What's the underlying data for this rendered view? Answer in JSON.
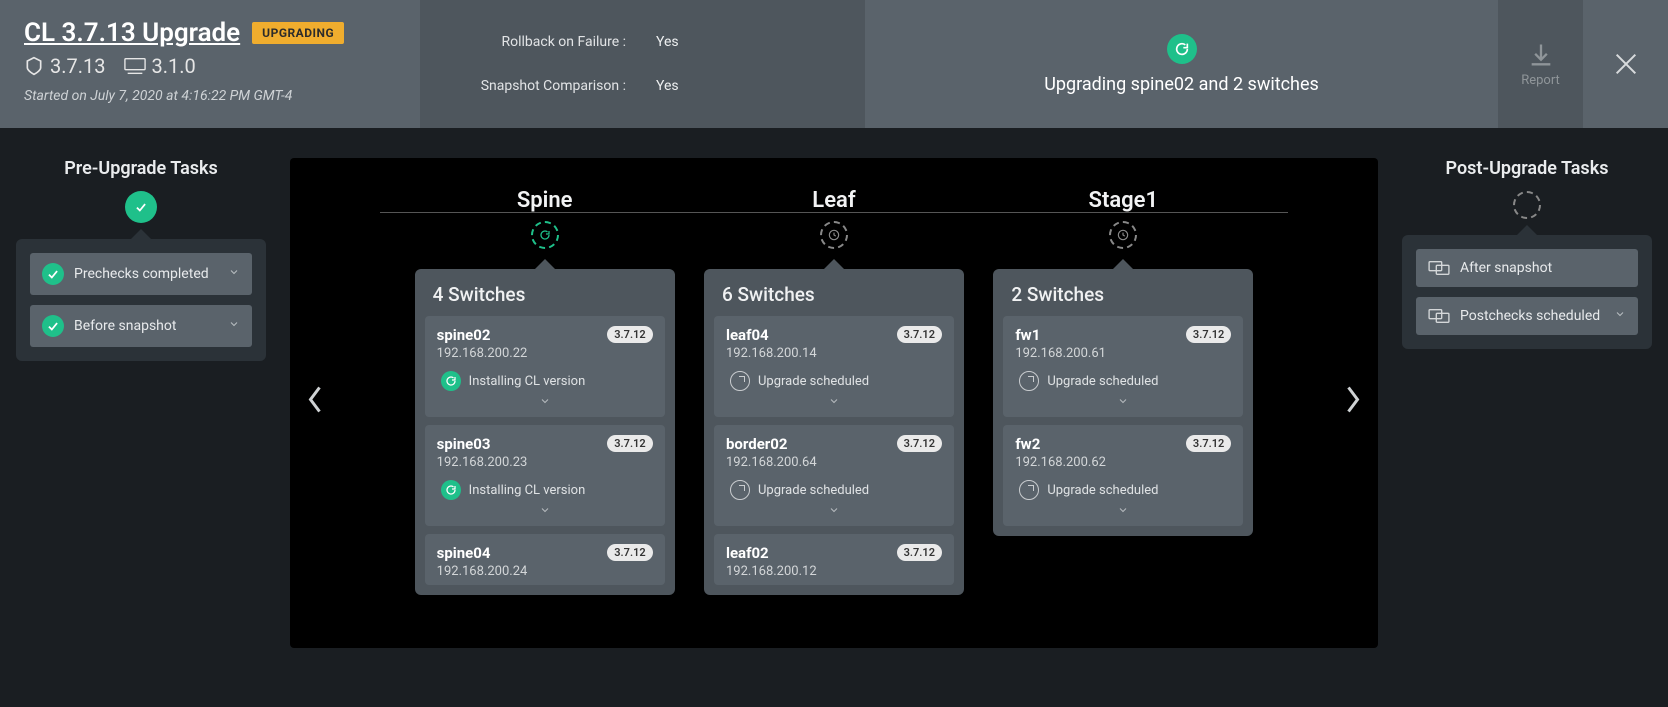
{
  "header": {
    "title": "CL 3.7.13 Upgrade",
    "badge": "UPGRADING",
    "cl_version": "3.7.13",
    "netq_version": "3.1.0",
    "started": "Started on July 7, 2020 at 4:16:22 PM GMT-4",
    "rollback_label": "Rollback on Failure :",
    "rollback_value": "Yes",
    "snapshot_label": "Snapshot Comparison :",
    "snapshot_value": "Yes",
    "status_text": "Upgrading spine02 and 2 switches",
    "report_label": "Report"
  },
  "pre_tasks": {
    "title": "Pre-Upgrade Tasks",
    "items": [
      {
        "label": "Prechecks completed",
        "status": "done"
      },
      {
        "label": "Before snapshot",
        "status": "done"
      }
    ]
  },
  "post_tasks": {
    "title": "Post-Upgrade Tasks",
    "items": [
      {
        "label": "After snapshot"
      },
      {
        "label": "Postchecks scheduled"
      }
    ]
  },
  "stages": [
    {
      "name": "Spine",
      "icon": "cycle",
      "count_label": "4 Switches",
      "switches": [
        {
          "name": "spine02",
          "ip": "192.168.200.22",
          "ver": "3.7.12",
          "status": "Installing CL version",
          "status_icon": "cycle"
        },
        {
          "name": "spine03",
          "ip": "192.168.200.23",
          "ver": "3.7.12",
          "status": "Installing CL version",
          "status_icon": "cycle"
        },
        {
          "name": "spine04",
          "ip": "192.168.200.24",
          "ver": "3.7.12",
          "status": "",
          "status_icon": ""
        }
      ]
    },
    {
      "name": "Leaf",
      "icon": "clock",
      "count_label": "6 Switches",
      "switches": [
        {
          "name": "leaf04",
          "ip": "192.168.200.14",
          "ver": "3.7.12",
          "status": "Upgrade scheduled",
          "status_icon": "clock"
        },
        {
          "name": "border02",
          "ip": "192.168.200.64",
          "ver": "3.7.12",
          "status": "Upgrade scheduled",
          "status_icon": "clock"
        },
        {
          "name": "leaf02",
          "ip": "192.168.200.12",
          "ver": "3.7.12",
          "status": "",
          "status_icon": ""
        }
      ]
    },
    {
      "name": "Stage1",
      "icon": "clock",
      "count_label": "2 Switches",
      "switches": [
        {
          "name": "fw1",
          "ip": "192.168.200.61",
          "ver": "3.7.12",
          "status": "Upgrade scheduled",
          "status_icon": "clock"
        },
        {
          "name": "fw2",
          "ip": "192.168.200.62",
          "ver": "3.7.12",
          "status": "Upgrade scheduled",
          "status_icon": "clock"
        }
      ]
    }
  ]
}
